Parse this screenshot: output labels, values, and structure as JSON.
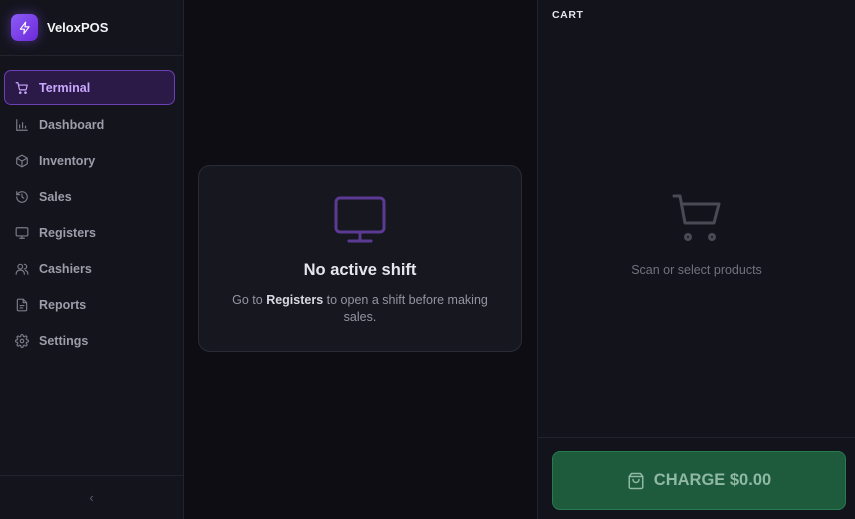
{
  "brand": {
    "name": "VeloxPOS",
    "logo_icon": "lightning-icon",
    "accent": "#8b5cf6"
  },
  "sidebar": {
    "items": [
      {
        "label": "Terminal",
        "icon": "cart-icon",
        "active": true
      },
      {
        "label": "Dashboard",
        "icon": "bar-chart-icon"
      },
      {
        "label": "Inventory",
        "icon": "box-icon"
      },
      {
        "label": "Sales",
        "icon": "history-icon"
      },
      {
        "label": "Registers",
        "icon": "monitor-icon"
      },
      {
        "label": "Cashiers",
        "icon": "users-icon"
      },
      {
        "label": "Reports",
        "icon": "file-icon"
      },
      {
        "label": "Settings",
        "icon": "gear-icon"
      }
    ],
    "collapse_glyph": "‹"
  },
  "main": {
    "empty_state": {
      "icon": "monitor-icon",
      "title": "No active shift",
      "text_prefix": "Go to ",
      "text_link": "Registers",
      "text_suffix": " to open a shift before making sales."
    }
  },
  "cart": {
    "title": "CART",
    "empty_icon": "cart-icon",
    "empty_text": "Scan or select products",
    "charge_label": "CHARGE $0.00",
    "charge_color": "#1e5a3c"
  }
}
